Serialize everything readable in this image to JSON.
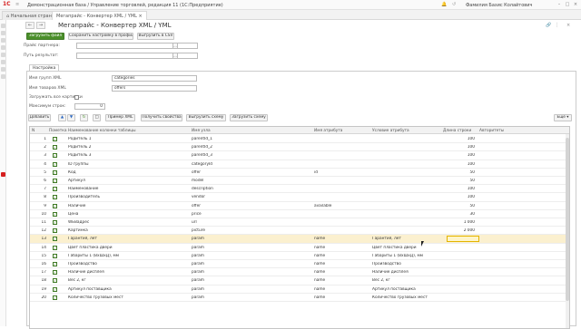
{
  "window": {
    "logo": "1С",
    "title": "Демонстрационная база / Управление торговлей, редакция 11  (1С:Предприятие)",
    "user": "Фамилия Базис Колайтович"
  },
  "tabs": [
    {
      "label": "Начальная страница"
    },
    {
      "label": "Мегапрайс - Конвертер XML / YML"
    }
  ],
  "form": {
    "title": "Мегапрайс - Конвертер XML / YML",
    "buttons": {
      "load": "Загрузить файл",
      "save_settings": "Сохранить настройку в профиль",
      "export_csv": "Выгрузить в CSV"
    },
    "fields": {
      "price_label": "Прайс партнера:",
      "price_value": "",
      "result_label": "Путь результат:",
      "result_value": ""
    },
    "settings_tab": "Настройка",
    "settings": {
      "group_node_label": "Имя групп XML",
      "group_node_value": "categories",
      "goods_node_label": "Имя товаров XML",
      "goods_node_value": "offers",
      "load_pictures_label": "Загружать все картинки",
      "max_rows_label": "Максимум строк:",
      "max_rows_value": "0"
    },
    "toolbar": {
      "add": "Добавить",
      "example_xml": "Пример XML",
      "get_properties": "Получить свойства",
      "export_schema": "Выгрузить схему",
      "import_schema": "Загрузить схему",
      "more": "Еще"
    }
  },
  "grid": {
    "columns": [
      "N",
      "Пометка",
      "Наименование колонки таблицы",
      "Имя узла",
      "Имя атрибута",
      "Условие атрибута",
      "Длина строки",
      "Авторитеты"
    ],
    "rows": [
      {
        "n": "1",
        "name": "Родитель 1",
        "node": "parentId_1",
        "attr": "",
        "cond": "",
        "len": "100"
      },
      {
        "n": "2",
        "name": "Родитель 2",
        "node": "parentId_2",
        "attr": "",
        "cond": "",
        "len": "100"
      },
      {
        "n": "3",
        "name": "Родитель 3",
        "node": "parentId_3",
        "attr": "",
        "cond": "",
        "len": "100"
      },
      {
        "n": "4",
        "name": "ID группы",
        "node": "categoryId",
        "attr": "",
        "cond": "",
        "len": "100"
      },
      {
        "n": "5",
        "name": "Код",
        "node": "offer",
        "attr": "id",
        "cond": "",
        "len": "50"
      },
      {
        "n": "6",
        "name": "Артикул",
        "node": "model",
        "attr": "",
        "cond": "",
        "len": "50"
      },
      {
        "n": "7",
        "name": "Наименование",
        "node": "description",
        "attr": "",
        "cond": "",
        "len": "100"
      },
      {
        "n": "8",
        "name": "Производитель",
        "node": "vendor",
        "attr": "",
        "cond": "",
        "len": "100"
      },
      {
        "n": "9",
        "name": "Наличие",
        "node": "offer",
        "attr": "available",
        "cond": "",
        "len": "50"
      },
      {
        "n": "10",
        "name": "Цена",
        "node": "price",
        "attr": "",
        "cond": "",
        "len": "30"
      },
      {
        "n": "11",
        "name": "WEBадрес",
        "node": "url",
        "attr": "",
        "cond": "",
        "len": "1 000"
      },
      {
        "n": "12",
        "name": "Картинка",
        "node": "picture",
        "attr": "",
        "cond": "",
        "len": "2 000"
      },
      {
        "n": "13",
        "name": "Гарантия, лет",
        "node": "param",
        "attr": "name",
        "cond": "Гарантия, лет",
        "len": ""
      },
      {
        "n": "14",
        "name": "Цвет пластика двери",
        "node": "param",
        "attr": "name",
        "cond": "Цвет пластика двери",
        "len": ""
      },
      {
        "n": "15",
        "name": "Габариты 1 (ВхШхД), мм",
        "node": "param",
        "attr": "name",
        "cond": "Габариты 1 (ВхШхД), мм",
        "len": ""
      },
      {
        "n": "16",
        "name": "Производство",
        "node": "param",
        "attr": "name",
        "cond": "Производство",
        "len": ""
      },
      {
        "n": "17",
        "name": "Наличие дисплея",
        "node": "param",
        "attr": "name",
        "cond": "Наличие дисплея",
        "len": ""
      },
      {
        "n": "18",
        "name": "Вес 2, кг",
        "node": "param",
        "attr": "name",
        "cond": "Вес 2, кг",
        "len": ""
      },
      {
        "n": "19",
        "name": "Артикул поставщика",
        "node": "param",
        "attr": "name",
        "cond": "Артикул поставщика",
        "len": ""
      },
      {
        "n": "20",
        "name": "Количество грузовых мест",
        "node": "param",
        "attr": "name",
        "cond": "Количество грузовых мест",
        "len": ""
      }
    ],
    "selected_row": "13"
  },
  "colors": {
    "accent": "#4a8f2a",
    "selection": "#fbf0cf",
    "brand": "#d61f1f"
  }
}
